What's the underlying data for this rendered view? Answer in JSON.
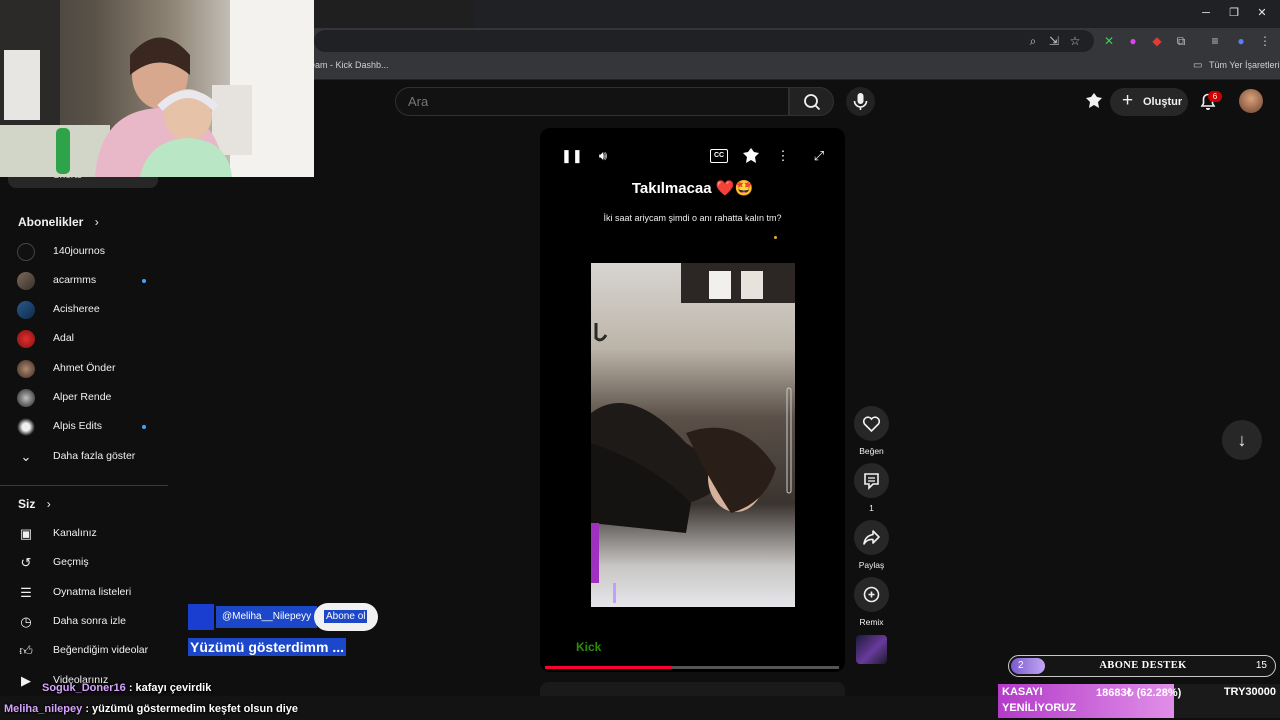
{
  "browser": {
    "bookmark_kick": "eam - Kick Dashb...",
    "bookmark_all": "Tüm Yer İşaretleri"
  },
  "header": {
    "search_placeholder": "Ara",
    "create_label": "Oluştur",
    "notification_count": "6"
  },
  "sidebar": {
    "shorts_partial": "Shorts",
    "subscriptions_heading": "Abonelikler",
    "subscriptions": [
      {
        "label": "140journos",
        "new": false
      },
      {
        "label": "acarmms",
        "new": true
      },
      {
        "label": "Acisheree",
        "new": false
      },
      {
        "label": "Adal",
        "new": false
      },
      {
        "label": "Ahmet Önder",
        "new": false
      },
      {
        "label": "Alper Rende",
        "new": false
      },
      {
        "label": "Alpis Edits",
        "new": true
      }
    ],
    "show_more_label": "Daha fazla göster",
    "you_heading": "Siz",
    "you_items": [
      {
        "label": "Kanalınız",
        "icon": "channel-icon"
      },
      {
        "label": "Geçmiş",
        "icon": "history-icon"
      },
      {
        "label": "Oynatma listeleri",
        "icon": "playlists-icon"
      },
      {
        "label": "Daha sonra izle",
        "icon": "watch-later-icon"
      },
      {
        "label": "Beğendiğim videolar",
        "icon": "liked-icon"
      },
      {
        "label": "Videolarınız",
        "icon": "your-videos-icon"
      }
    ]
  },
  "short": {
    "title": "Takılmacaa ❤️🤩",
    "subtitle": "İki saat ariycam şimdi o anı rahatta kalın tm?",
    "watermark": "Kick",
    "channel_handle": "@Meliha__Nilepeyy",
    "subscribe_label": "Abone ol",
    "caption": "Yüzümü gösterdimm ...",
    "progress": 0.43
  },
  "actions": {
    "like_label": "Beğen",
    "comment_count": "1",
    "share_label": "Paylaş",
    "remix_label": "Remix"
  },
  "stream": {
    "chat": [
      {
        "user": "Soguk_Doner16",
        "text": ": kafayı çevirdik"
      },
      {
        "user": "Meliha_nilepey",
        "text": ": yüzümü göstermedim keşfet olsun diye"
      }
    ],
    "abone_destek": {
      "count": "2",
      "title": "ABONE DESTEK",
      "goal": "15",
      "progress": 0.13
    },
    "kasa": {
      "line1": "KASAYI",
      "line2": "YENİLİYORUZ",
      "amount": "18683₺ (62.28%)",
      "goal": "TRY30000",
      "progress": 0.6228
    }
  },
  "colors": {
    "youtube_bg": "#0f0f0f",
    "accent_red": "#ff0033",
    "badge_blue": "#3ea6ff",
    "kick_green": "#53fc18",
    "highlight_blue": "#1c47c9"
  }
}
